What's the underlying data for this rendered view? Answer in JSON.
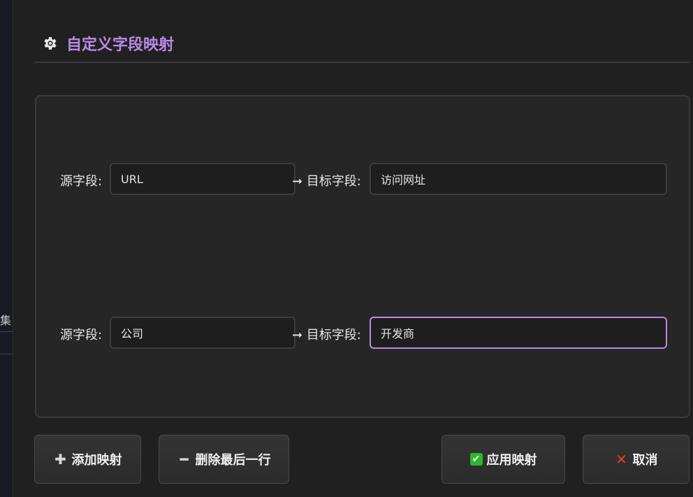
{
  "sidebar": {
    "partial_text": "集"
  },
  "dialog": {
    "title": "自定义字段映射",
    "icon": "gear-icon"
  },
  "mappings": [
    {
      "source_label": "源字段:",
      "source_value": "URL",
      "target_label": "➞ 目标字段:",
      "target_value": "访问网址",
      "focused": false
    },
    {
      "source_label": "源字段:",
      "source_value": "公司",
      "target_label": "➞ 目标字段:",
      "target_value": "开发商",
      "focused": true
    }
  ],
  "buttons": {
    "add_label": "添加映射",
    "delete_label": "删除最后一行",
    "apply_label": "应用映射",
    "cancel_label": "取消"
  },
  "colors": {
    "accent": "#b98ae6",
    "apply_check": "#2fb52f",
    "cancel_x": "#e0412b"
  }
}
